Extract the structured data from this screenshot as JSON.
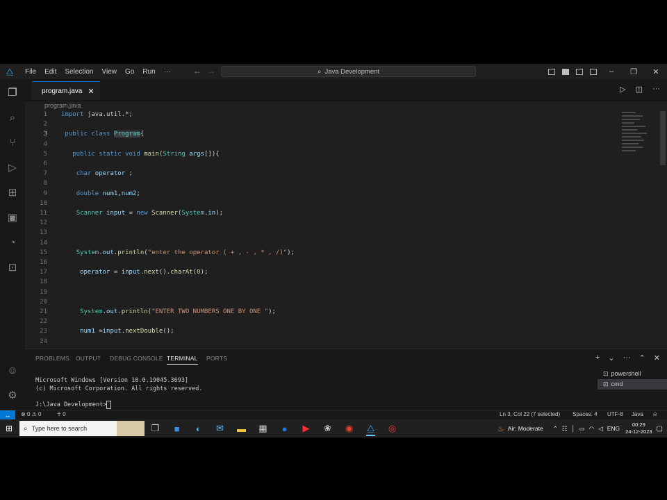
{
  "titlebar": {
    "menus": [
      "File",
      "Edit",
      "Selection",
      "View",
      "Go",
      "Run",
      "···"
    ],
    "search_text": "Java Development"
  },
  "editor": {
    "tab_name": "program.java",
    "breadcrumb": "program.java",
    "lines": [
      {
        "n": "1",
        "html": "<span class='kw'>import</span> <span class='plain'>java.util.*;</span>"
      },
      {
        "n": "2",
        "html": ""
      },
      {
        "n": "3",
        "html": " <span class='kw'>public</span> <span class='kw'>class</span> <span class='ty hl'>Program</span><span class='plain'>{</span>"
      },
      {
        "n": "4",
        "html": ""
      },
      {
        "n": "5",
        "html": "   <span class='kw'>public</span> <span class='kw'>static</span> <span class='kw'>void</span> <span class='fn'>main</span><span class='plain'>(</span><span class='ty'>String</span> <span class='var'>args</span><span class='plain'>[]){</span>"
      },
      {
        "n": "6",
        "html": ""
      },
      {
        "n": "7",
        "html": "    <span class='kw'>char</span> <span class='var'>operator</span> <span class='plain'>;</span>"
      },
      {
        "n": "8",
        "html": ""
      },
      {
        "n": "9",
        "html": "    <span class='kw'>double</span> <span class='var'>num1</span><span class='plain'>,</span><span class='var'>num2</span><span class='plain'>;</span>"
      },
      {
        "n": "10",
        "html": ""
      },
      {
        "n": "11",
        "html": "    <span class='ty'>Scanner</span> <span class='var'>input</span> <span class='plain'>=</span> <span class='kw'>new</span> <span class='fn'>Scanner</span><span class='plain'>(</span><span class='ty'>System</span><span class='plain'>.</span><span class='var'>in</span><span class='plain'>);</span>"
      },
      {
        "n": "12",
        "html": ""
      },
      {
        "n": "13",
        "html": ""
      },
      {
        "n": "14",
        "html": ""
      },
      {
        "n": "15",
        "html": "    <span class='ty'>System</span><span class='plain'>.</span><span class='var'>out</span><span class='plain'>.</span><span class='fn'>println</span><span class='plain'>(</span><span class='str'>\"enter the operator ( + , - , * , /)\"</span><span class='plain'>);</span>"
      },
      {
        "n": "16",
        "html": ""
      },
      {
        "n": "17",
        "html": "     <span class='var'>operator</span> <span class='plain'>=</span> <span class='var'>input</span><span class='plain'>.</span><span class='fn'>next</span><span class='plain'>().</span><span class='fn'>charAt</span><span class='plain'>(</span><span class='num'>0</span><span class='plain'>);</span>"
      },
      {
        "n": "18",
        "html": ""
      },
      {
        "n": "19",
        "html": ""
      },
      {
        "n": "20",
        "html": ""
      },
      {
        "n": "21",
        "html": "     <span class='ty'>System</span><span class='plain'>.</span><span class='var'>out</span><span class='plain'>.</span><span class='fn'>println</span><span class='plain'>(</span><span class='str'>\"ENTER TWO NUMBERS ONE BY ONE \"</span><span class='plain'>);</span>"
      },
      {
        "n": "22",
        "html": ""
      },
      {
        "n": "23",
        "html": "     <span class='var'>num1</span> <span class='plain'>=</span><span class='var'>input</span><span class='plain'>.</span><span class='fn'>nextDouble</span><span class='plain'>();</span>"
      },
      {
        "n": "24",
        "html": ""
      }
    ],
    "active_line": "3"
  },
  "panel": {
    "tabs": [
      "PROBLEMS",
      "OUTPUT",
      "DEBUG CONSOLE",
      "TERMINAL",
      "PORTS"
    ],
    "active_tab": "TERMINAL",
    "terminal_lines": [
      "Microsoft Windows [Version 10.0.19045.3693]",
      "(c) Microsoft Corporation. All rights reserved.",
      "",
      "J:\\Java Development>"
    ],
    "terminals": [
      "powershell",
      "cmd"
    ],
    "active_terminal": "cmd"
  },
  "statusbar": {
    "errors": "0",
    "warnings": "0",
    "ports": "0",
    "cursor": "Ln 3, Col 22 (7 selected)",
    "spaces": "Spaces: 4",
    "encoding": "UTF-8",
    "language": "Java"
  },
  "taskbar": {
    "search_placeholder": "Type here to search",
    "weather": "Air: Moderate",
    "lang": "ENG",
    "time": "00:29",
    "date": "24-12-2023"
  }
}
